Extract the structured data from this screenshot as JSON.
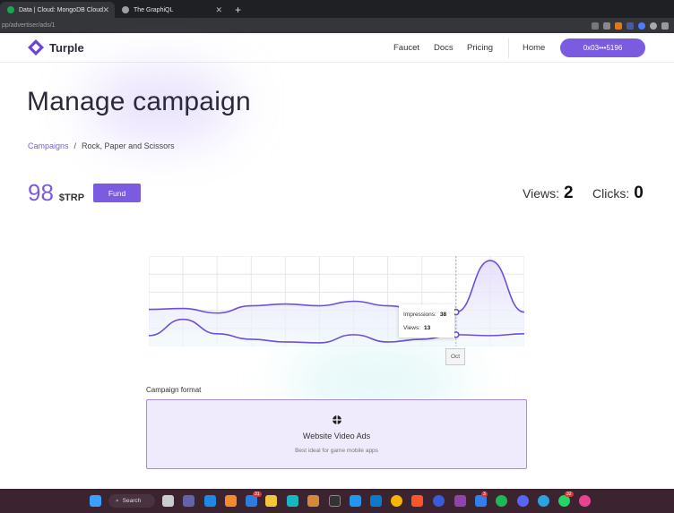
{
  "browser": {
    "tabs": [
      {
        "title": "Data | Cloud: MongoDB Cloud"
      },
      {
        "title": "The GraphiQL"
      }
    ],
    "new_tab": "+",
    "url": "pp/advertiser/ads/1"
  },
  "header": {
    "brand": "Turple",
    "nav": [
      "Faucet",
      "Docs",
      "Pricing"
    ],
    "home": "Home",
    "wallet": "0x03•••5196"
  },
  "page": {
    "title": "Manage campaign",
    "breadcrumb": {
      "root": "Campaigns",
      "sep": "/",
      "current": "Rock, Paper and Scissors"
    },
    "balance": {
      "value": "98",
      "currency": "$TRP"
    },
    "fund_label": "Fund",
    "views": {
      "label": "Views:",
      "value": "2"
    },
    "clicks": {
      "label": "Clicks:",
      "value": "0"
    }
  },
  "chart_data": {
    "type": "area",
    "x": [
      "",
      "",
      "",
      "",
      "",
      "",
      "",
      "",
      "",
      "Oct",
      ""
    ],
    "series": [
      {
        "name": "Impressions",
        "values": [
          41,
          42,
          37,
          45,
          47,
          45,
          50,
          45,
          40,
          38,
          95,
          38
        ]
      },
      {
        "name": "Views",
        "values": [
          12,
          30,
          14,
          8,
          5,
          4,
          13,
          5,
          8,
          13,
          12,
          14
        ]
      }
    ],
    "ylim": [
      0,
      100
    ],
    "grid": true,
    "tooltip": {
      "x": "Oct",
      "impressions_label": "Impressions:",
      "impressions": "38",
      "views_label": "Views:",
      "views": "13"
    }
  },
  "format": {
    "label": "Campaign format",
    "name": "Website Video Ads",
    "description": "Best ideal for game mobile apps"
  },
  "taskbar": {
    "search": "Search",
    "badges": [
      "31",
      "3",
      "32"
    ]
  },
  "colors": {
    "accent": "#7b5be0",
    "line": "#6f4fd6",
    "fill": "#e6dcfb"
  }
}
